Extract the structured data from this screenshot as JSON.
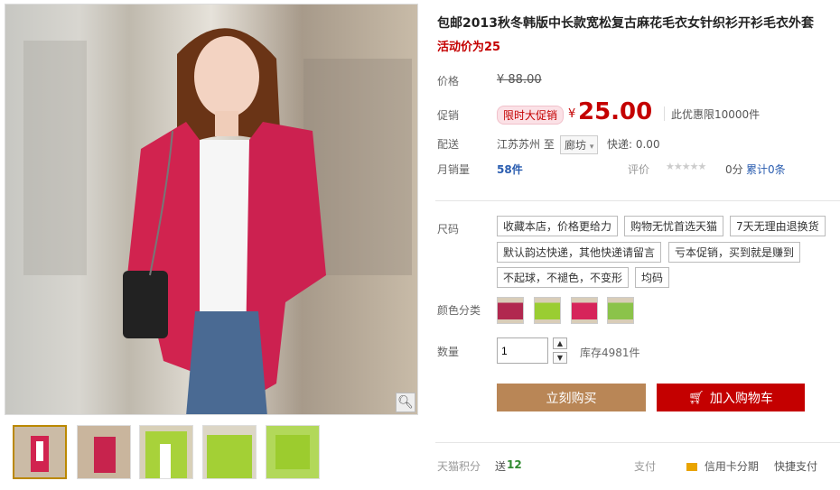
{
  "product": {
    "title": "包邮2013秋冬韩版中长款宽松复古麻花毛衣女针织衫开衫毛衣外套",
    "promo": "活动价为25"
  },
  "price": {
    "label": "价格",
    "original": "¥ 88.00",
    "promo_label": "促销",
    "promo_tag": "限时大促销",
    "currency": "¥",
    "value": "25.00",
    "limit": "此优惠限10000件"
  },
  "shipping": {
    "label": "配送",
    "from": "江苏苏州 至",
    "to": "廊坊",
    "express": "快递: 0.00"
  },
  "sales": {
    "label": "月销量",
    "count": "58件",
    "rating_label": "评价",
    "stars": "★★★★★",
    "score": "0分",
    "reviews": "累计0条"
  },
  "size": {
    "label": "尺码",
    "options": [
      "收藏本店，价格更给力",
      "购物无忧首选天猫",
      "7天无理由退换货",
      "默认韵达快递，其他快递请留言",
      "亏本促销，买到就是赚到",
      "不起球，不褪色，不变形",
      "均码"
    ]
  },
  "color": {
    "label": "颜色分类",
    "swatches": [
      "#b1284f",
      "#9acd32",
      "#d6245a",
      "#8bc34a"
    ]
  },
  "quantity": {
    "label": "数量",
    "value": "1",
    "up": "▲",
    "down": "▼",
    "stock": "库存4981件"
  },
  "actions": {
    "buy": "立刻购买",
    "cart": "加入购物车"
  },
  "footer": {
    "points_label": "天猫积分",
    "points_prefix": "送",
    "points_value": "12",
    "pay_label": "支付",
    "credit": "信用卡分期",
    "quick_pay": "快捷支付"
  },
  "icons": {
    "zoom": "magnifier-icon",
    "cart": "cart-icon",
    "card": "credit-card-icon"
  }
}
